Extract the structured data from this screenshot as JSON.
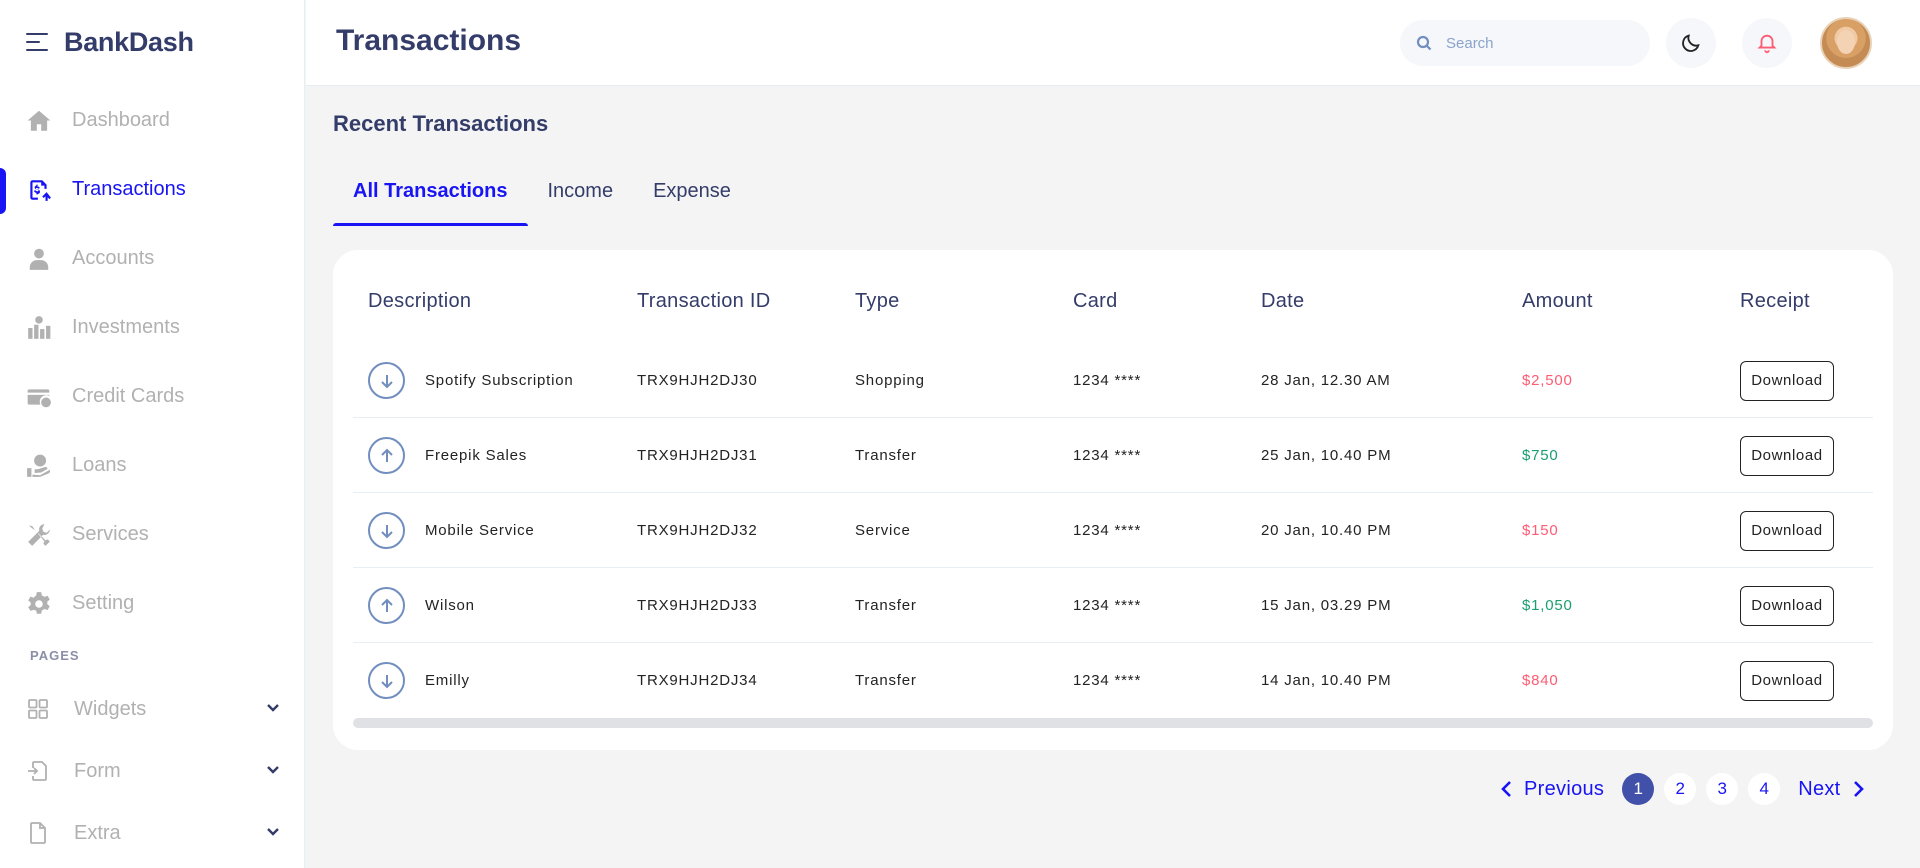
{
  "app": {
    "brand": "BankDash"
  },
  "sidebar": {
    "items": [
      {
        "label": "Dashboard",
        "icon": "home-icon"
      },
      {
        "label": "Transactions",
        "icon": "transfer-icon",
        "active": true
      },
      {
        "label": "Accounts",
        "icon": "user-icon"
      },
      {
        "label": "Investments",
        "icon": "investment-icon"
      },
      {
        "label": "Credit Cards",
        "icon": "credit-card-icon"
      },
      {
        "label": "Loans",
        "icon": "loan-icon"
      },
      {
        "label": "Services",
        "icon": "service-icon"
      },
      {
        "label": "Setting",
        "icon": "gear-icon"
      }
    ],
    "pages_label": "PAGES",
    "pages": [
      {
        "label": "Widgets",
        "icon": "widgets-icon"
      },
      {
        "label": "Form",
        "icon": "form-icon"
      },
      {
        "label": "Extra",
        "icon": "document-icon"
      }
    ]
  },
  "header": {
    "title": "Transactions",
    "search_placeholder": "Search"
  },
  "main": {
    "section_title": "Recent Transactions",
    "tabs": [
      {
        "label": "All Transactions",
        "active": true
      },
      {
        "label": "Income"
      },
      {
        "label": "Expense"
      }
    ],
    "table": {
      "columns": [
        "Description",
        "Transaction ID",
        "Type",
        "Card",
        "Date",
        "Amount",
        "Receipt"
      ],
      "rows": [
        {
          "direction": "down",
          "description": "Spotify Subscription",
          "id": "TRX9HJH2DJ30",
          "type": "Shopping",
          "card": "1234 ****",
          "date": "28 Jan, 12.30 AM",
          "amount": "$2,500",
          "amount_kind": "negative",
          "receipt": "Download"
        },
        {
          "direction": "up",
          "description": "Freepik Sales",
          "id": "TRX9HJH2DJ31",
          "type": "Transfer",
          "card": "1234 ****",
          "date": "25 Jan, 10.40 PM",
          "amount": "$750",
          "amount_kind": "positive",
          "receipt": "Download"
        },
        {
          "direction": "down",
          "description": "Mobile Service",
          "id": "TRX9HJH2DJ32",
          "type": "Service",
          "card": "1234 ****",
          "date": "20 Jan, 10.40 PM",
          "amount": "$150",
          "amount_kind": "negative",
          "receipt": "Download"
        },
        {
          "direction": "up",
          "description": "Wilson",
          "id": "TRX9HJH2DJ33",
          "type": "Transfer",
          "card": "1234 ****",
          "date": "15 Jan, 03.29 PM",
          "amount": "$1,050",
          "amount_kind": "positive",
          "receipt": "Download"
        },
        {
          "direction": "down",
          "description": "Emilly",
          "id": "TRX9HJH2DJ34",
          "type": "Transfer",
          "card": "1234 ****",
          "date": "14 Jan, 10.40 PM",
          "amount": "$840",
          "amount_kind": "negative",
          "receipt": "Download"
        }
      ]
    },
    "pagination": {
      "previous": "Previous",
      "next": "Next",
      "pages": [
        "1",
        "2",
        "3",
        "4"
      ],
      "current": "1"
    }
  },
  "colors": {
    "accent": "#1814f3",
    "text": "#343c6a",
    "muted": "#b1b1b1",
    "negative": "#fe5c73",
    "positive": "#1a9e6f"
  }
}
